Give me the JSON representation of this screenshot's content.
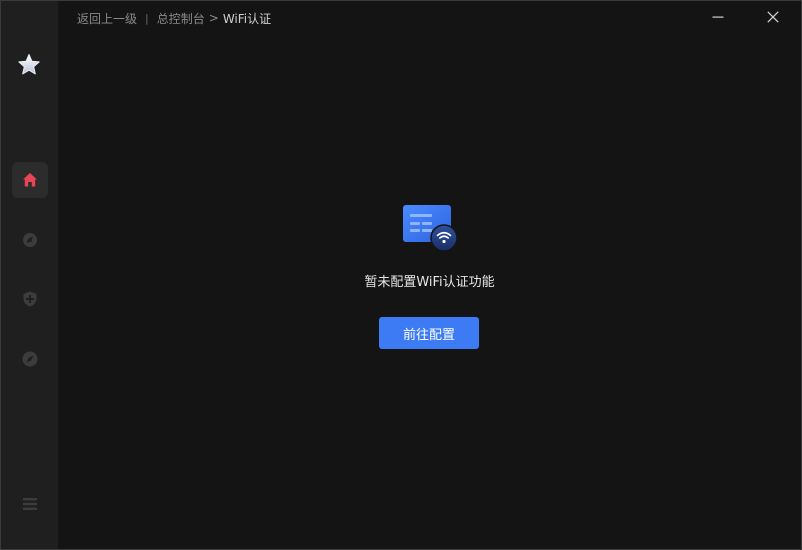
{
  "breadcrumb": {
    "back_label": "返回上一级",
    "separator": "|",
    "parent_label": "总控制台",
    "arrow": ">",
    "current_label": "WiFi认证"
  },
  "window_controls": {
    "minimize_icon": "minimize-icon",
    "close_icon": "close-icon"
  },
  "sidebar": {
    "logo_icon": "star-logo-icon",
    "items": [
      {
        "icon": "home-icon",
        "active": true
      },
      {
        "icon": "clean-icon",
        "active": false
      },
      {
        "icon": "shield-plus-icon",
        "active": false
      },
      {
        "icon": "compass-icon",
        "active": false
      }
    ],
    "menu_icon": "menu-icon"
  },
  "empty_state": {
    "icon": "wifi-card-icon",
    "message": "暂未配置WiFi认证功能",
    "button_label": "前往配置"
  },
  "colors": {
    "accent": "#3d7bf5",
    "active_icon": "#e8455a",
    "background": "#141414",
    "sidebar": "#1f1f1f"
  }
}
